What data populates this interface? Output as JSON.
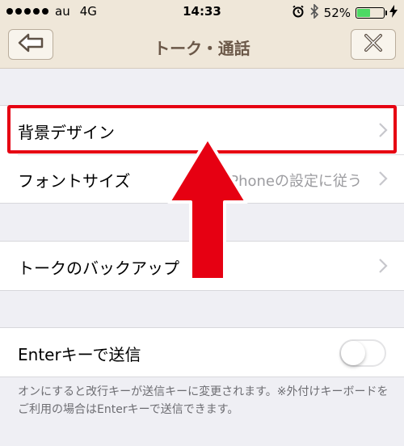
{
  "status_bar": {
    "carrier": "au",
    "network": "4G",
    "time": "14:33",
    "battery_percent": "52%",
    "battery_level": 0.52,
    "icons": [
      "alarm-icon",
      "bluetooth-icon",
      "battery-icon",
      "charging-icon"
    ]
  },
  "nav": {
    "title": "トーク・通話",
    "back_icon": "back-arrow-icon",
    "close_icon": "close-icon"
  },
  "settings": {
    "background_design": {
      "label": "背景デザイン"
    },
    "font_size": {
      "label": "フォントサイズ",
      "value": "iPhoneの設定に従う"
    },
    "talk_backup": {
      "label": "トークのバックアップ"
    },
    "enter_send": {
      "label": "Enterキーで送信",
      "enabled": false
    }
  },
  "footnote": "オンにすると改行キーが送信キーに変更されます。※外付けキーボードをご利用の場合はEnterキーで送信できます。",
  "colors": {
    "highlight": "#e60012",
    "nav_background": "#efe7d9",
    "nav_title": "#6b5848",
    "toggle_border": "#e4e4e6"
  }
}
